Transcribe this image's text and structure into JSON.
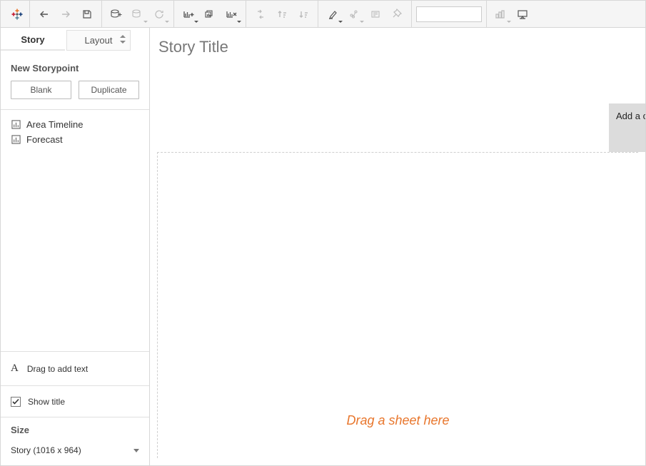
{
  "sidebar": {
    "tabs": {
      "story": "Story",
      "layout": "Layout"
    },
    "new_storypoint": "New Storypoint",
    "blank": "Blank",
    "duplicate": "Duplicate",
    "sheets": [
      {
        "label": "Area Timeline"
      },
      {
        "label": "Forecast"
      }
    ],
    "drag_text": "Drag to add text",
    "show_title": "Show title",
    "size_heading": "Size",
    "size_value": "Story (1016 x 964)"
  },
  "canvas": {
    "title": "Story Title",
    "caption_placeholder": "Add a caption",
    "drop_hint": "Drag a sheet here"
  }
}
